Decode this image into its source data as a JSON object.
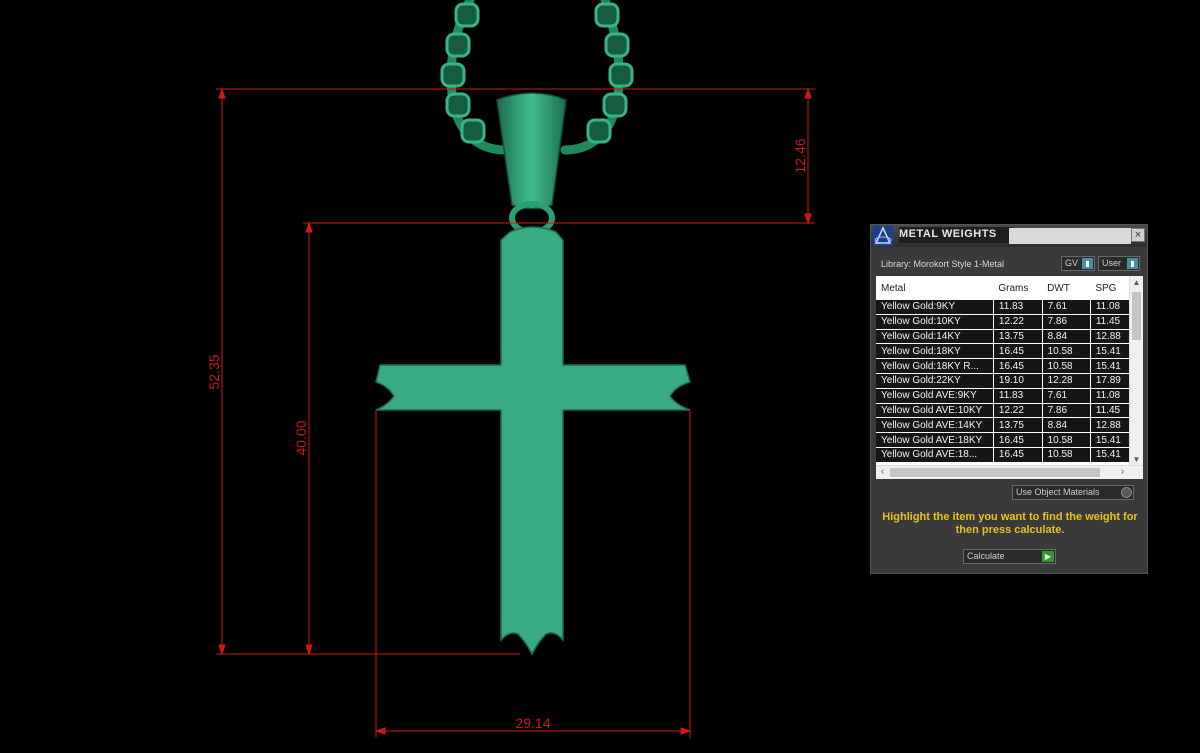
{
  "viewport": {
    "background": "#000000",
    "model_color": "#3aab84",
    "dimension_color": "#d01818",
    "dimensions": {
      "total_height": "52.35",
      "body_height": "40.00",
      "bail_height": "12.46",
      "width": "29.14"
    }
  },
  "panel": {
    "title": "METAL WEIGHTS",
    "close_label": "×",
    "library_label": "Library: Morokort Style 1-Metal",
    "gv_select": "GV",
    "user_select": "User",
    "columns": [
      "Metal",
      "Grams",
      "DWT",
      "SPG"
    ],
    "rows": [
      [
        "Yellow Gold:9KY",
        "11.83",
        "7.61",
        "11.08"
      ],
      [
        "Yellow Gold:10KY",
        "12.22",
        "7.86",
        "11.45"
      ],
      [
        "Yellow Gold:14KY",
        "13.75",
        "8.84",
        "12.88"
      ],
      [
        "Yellow Gold:18KY",
        "16.45",
        "10.58",
        "15.41"
      ],
      [
        "Yellow Gold:18KY R...",
        "16.45",
        "10.58",
        "15.41"
      ],
      [
        "Yellow Gold:22KY",
        "19.10",
        "12.28",
        "17.89"
      ],
      [
        "Yellow Gold AVE:9KY",
        "11.83",
        "7.61",
        "11.08"
      ],
      [
        "Yellow Gold AVE:10KY",
        "12.22",
        "7.86",
        "11.45"
      ],
      [
        "Yellow Gold AVE:14KY",
        "13.75",
        "8.84",
        "12.88"
      ],
      [
        "Yellow Gold AVE:18KY",
        "16.45",
        "10.58",
        "15.41"
      ],
      [
        "Yellow Gold AVE:18...",
        "16.45",
        "10.58",
        "15.41"
      ]
    ],
    "use_object_materials": "Use Object Materials",
    "instruction": "Highlight the item you want to find the weight for then press calculate.",
    "calculate_label": "Calculate",
    "instruction_color": "#e8c21a"
  }
}
